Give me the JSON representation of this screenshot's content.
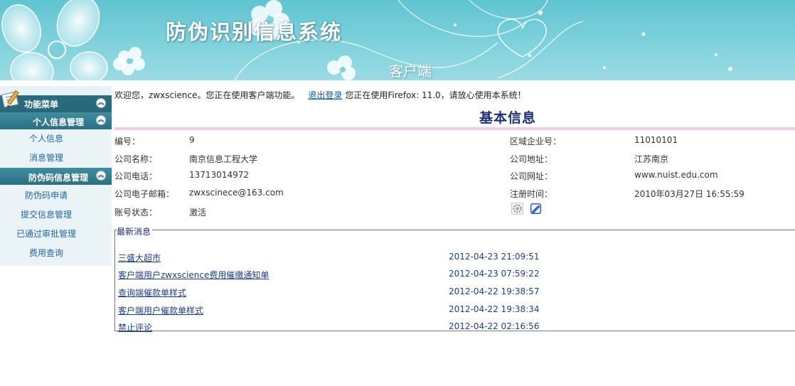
{
  "header": {
    "title": "防伪识别信息系统",
    "subtitle": "客户端"
  },
  "sidebar": {
    "menu_title": "功能菜单",
    "groups": [
      {
        "title": "个人信息管理",
        "items": [
          "个人信息",
          "消息管理"
        ]
      },
      {
        "title": "防伪码信息管理",
        "items": [
          "防伪码申请",
          "提交信息管理",
          "已通过审批管理",
          "费用查询"
        ]
      }
    ]
  },
  "main": {
    "welcome_prefix": "欢迎您，zwxscience。您正在使用客户端功能。",
    "logout_label": "退出登录",
    "welcome_suffix": "您正在使用Firefox: 11.0，请放心使用本系统！",
    "section_title": "基本信息",
    "fields": {
      "number_label": "编号：",
      "number_value": "9",
      "region_label": "区域企业号：",
      "region_value": "11010101",
      "company_label": "公司名称：",
      "company_value": "南京信息工程大学",
      "address_label": "公司地址：",
      "address_value": "江苏南京",
      "phone_label": "公司电话：",
      "phone_value": "13713014972",
      "website_label": "公司网址：",
      "website_value": "www.nuist.edu.com",
      "email_label": "公司电子邮箱：",
      "email_value": "zwxscinece@163.com",
      "regtime_label": "注册时间：",
      "regtime_value": "2010年03月27日 16:55:59",
      "status_label": "账号状态：",
      "status_value": "激活"
    },
    "action_icons": [
      "gear-icon",
      "edit-icon"
    ],
    "news": {
      "legend": "最新消息",
      "items": [
        {
          "title": "三盛大超市",
          "time": "2012-04-23 21:09:51"
        },
        {
          "title": "客户端用户zwxscience费用催缴通知单",
          "time": "2012-04-23 07:59:22"
        },
        {
          "title": "查询端催款单样式",
          "time": "2012-04-22 19:38:57"
        },
        {
          "title": "客户端用户催款单样式",
          "time": "2012-04-22 19:38:34"
        },
        {
          "title": "禁止评论",
          "time": "2012-04-22 02:16:56"
        }
      ]
    }
  }
}
